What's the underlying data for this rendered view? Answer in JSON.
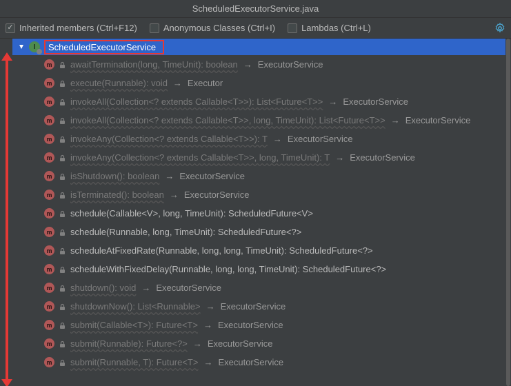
{
  "title": "ScheduledExecutorService.java",
  "toolbar": {
    "inherited": {
      "label": "Inherited members (Ctrl+F12)",
      "checked": true
    },
    "anonymous": {
      "label": "Anonymous Classes (Ctrl+I)",
      "checked": false
    },
    "lambdas": {
      "label": "Lambdas (Ctrl+L)",
      "checked": false
    }
  },
  "class": {
    "name": "ScheduledExecutorService",
    "icon_letter": "I"
  },
  "members": [
    {
      "sig": "awaitTermination(long, TimeUnit): boolean",
      "origin": "ExecutorService",
      "inherited": true
    },
    {
      "sig": "execute(Runnable): void",
      "origin": "Executor",
      "inherited": true
    },
    {
      "sig": "invokeAll(Collection<? extends Callable<T>>): List<Future<T>>",
      "origin": "ExecutorService",
      "inherited": true
    },
    {
      "sig": "invokeAll(Collection<? extends Callable<T>>, long, TimeUnit): List<Future<T>>",
      "origin": "ExecutorService",
      "inherited": true,
      "cut": true
    },
    {
      "sig": "invokeAny(Collection<? extends Callable<T>>): T",
      "origin": "ExecutorService",
      "inherited": true
    },
    {
      "sig": "invokeAny(Collection<? extends Callable<T>>, long, TimeUnit): T",
      "origin": "ExecutorService",
      "inherited": true
    },
    {
      "sig": "isShutdown(): boolean",
      "origin": "ExecutorService",
      "inherited": true
    },
    {
      "sig": "isTerminated(): boolean",
      "origin": "ExecutorService",
      "inherited": true
    },
    {
      "sig": "schedule(Callable<V>, long, TimeUnit): ScheduledFuture<V>",
      "origin": "",
      "inherited": false
    },
    {
      "sig": "schedule(Runnable, long, TimeUnit): ScheduledFuture<?>",
      "origin": "",
      "inherited": false
    },
    {
      "sig": "scheduleAtFixedRate(Runnable, long, long, TimeUnit): ScheduledFuture<?>",
      "origin": "",
      "inherited": false
    },
    {
      "sig": "scheduleWithFixedDelay(Runnable, long, long, TimeUnit): ScheduledFuture<?>",
      "origin": "",
      "inherited": false
    },
    {
      "sig": "shutdown(): void",
      "origin": "ExecutorService",
      "inherited": true
    },
    {
      "sig": "shutdownNow(): List<Runnable>",
      "origin": "ExecutorService",
      "inherited": true
    },
    {
      "sig": "submit(Callable<T>): Future<T>",
      "origin": "ExecutorService",
      "inherited": true
    },
    {
      "sig": "submit(Runnable): Future<?>",
      "origin": "ExecutorService",
      "inherited": true
    },
    {
      "sig": "submit(Runnable, T): Future<T>",
      "origin": "ExecutorService",
      "inherited": true
    }
  ],
  "method_icon_letter": "m",
  "arrow_glyph": "→",
  "colors": {
    "selection": "#2f65ca",
    "annotation": "#e53935",
    "gear": "#4aa0c9"
  }
}
